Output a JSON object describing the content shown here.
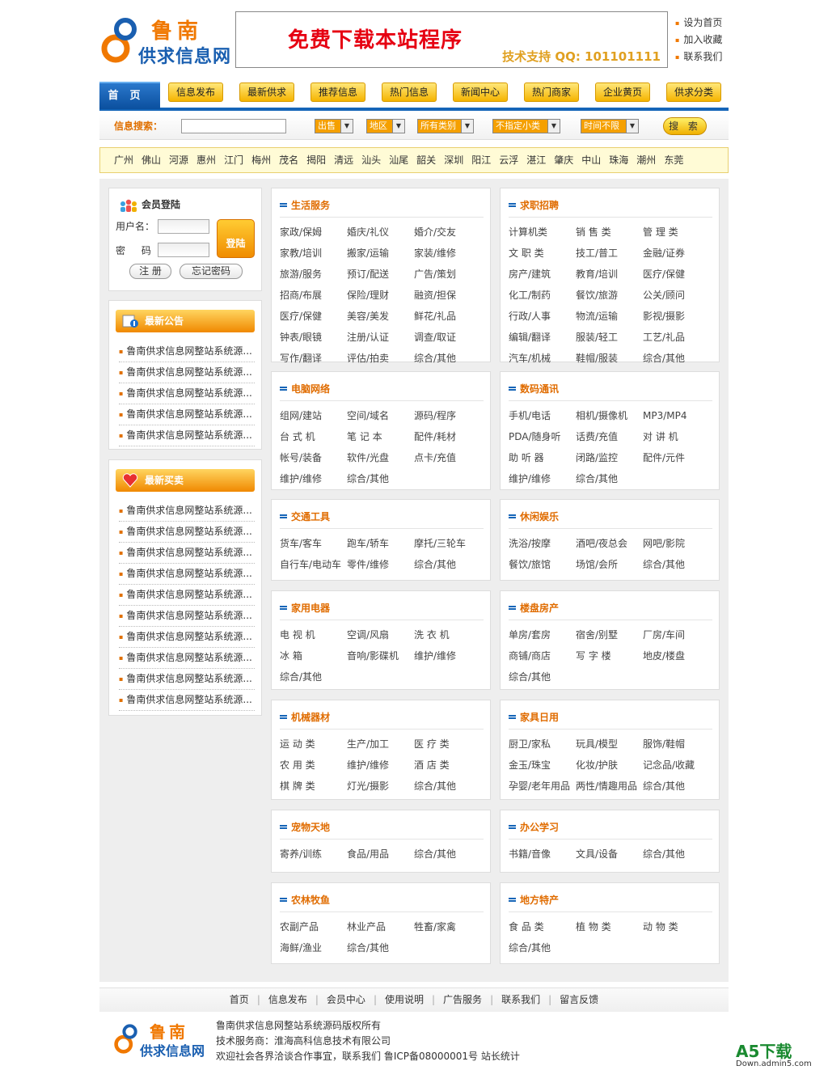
{
  "header": {
    "logo_line1": "鲁南",
    "logo_line2": "供求信息网",
    "banner_title": "免费下载本站程序",
    "banner_support": "技术支持 QQ: 101101111",
    "top_links": [
      "设为首页",
      "加入收藏",
      "联系我们"
    ]
  },
  "nav": {
    "home": "首页",
    "items": [
      "信息发布",
      "最新供求",
      "推荐信息",
      "热门信息",
      "新闻中心",
      "热门商家",
      "企业黄页",
      "供求分类"
    ]
  },
  "search": {
    "label": "信息搜索：",
    "input_value": "",
    "selects": [
      "出售",
      "地区",
      "所有类别",
      "不指定小类",
      "时间不限"
    ],
    "button": "搜 索"
  },
  "cities": [
    "广州",
    "佛山",
    "河源",
    "惠州",
    "江门",
    "梅州",
    "茂名",
    "揭阳",
    "清远",
    "汕头",
    "汕尾",
    "韶关",
    "深圳",
    "阳江",
    "云浮",
    "湛江",
    "肇庆",
    "中山",
    "珠海",
    "潮州",
    "东莞"
  ],
  "login": {
    "title": "会员登陆",
    "username_label": "用户名：",
    "password_label": "密 码：",
    "submit": "登陆",
    "register": "注 册",
    "forgot": "忘记密码"
  },
  "notice": {
    "title": "最新公告",
    "items": [
      "鲁南供求信息网整站系统源...",
      "鲁南供求信息网整站系统源...",
      "鲁南供求信息网整站系统源...",
      "鲁南供求信息网整站系统源...",
      "鲁南供求信息网整站系统源..."
    ]
  },
  "trades": {
    "title": "最新买卖",
    "items": [
      "鲁南供求信息网整站系统源...",
      "鲁南供求信息网整站系统源...",
      "鲁南供求信息网整站系统源...",
      "鲁南供求信息网整站系统源...",
      "鲁南供求信息网整站系统源...",
      "鲁南供求信息网整站系统源...",
      "鲁南供求信息网整站系统源...",
      "鲁南供求信息网整站系统源...",
      "鲁南供求信息网整站系统源...",
      "鲁南供求信息网整站系统源..."
    ]
  },
  "categories": [
    {
      "title": "生活服务",
      "items": [
        "家政/保姆",
        "婚庆/礼仪",
        "婚介/交友",
        "家教/培训",
        "搬家/运输",
        "家装/维修",
        "旅游/服务",
        "预订/配送",
        "广告/策划",
        "招商/布展",
        "保险/理财",
        "融资/担保",
        "医疗/保健",
        "美容/美发",
        "鲜花/礼品",
        "钟表/眼镜",
        "注册/认证",
        "调查/取证",
        "写作/翻译",
        "评估/拍卖",
        "综合/其他"
      ]
    },
    {
      "title": "求职招聘",
      "items": [
        "计算机类",
        "销 售 类",
        "管 理 类",
        "文 职 类",
        "技工/普工",
        "金融/证券",
        "房产/建筑",
        "教育/培训",
        "医疗/保健",
        "化工/制药",
        "餐饮/旅游",
        "公关/顾问",
        "行政/人事",
        "物流/运输",
        "影视/摄影",
        "编辑/翻译",
        "服装/轻工",
        "工艺/礼品",
        "汽车/机械",
        "鞋帽/服装",
        "综合/其他"
      ]
    },
    {
      "title": "电脑网络",
      "items": [
        "组网/建站",
        "空间/域名",
        "源码/程序",
        "台 式 机",
        "笔 记 本",
        "配件/耗材",
        "帐号/装备",
        "软件/光盘",
        "点卡/充值",
        "维护/维修",
        "综合/其他"
      ]
    },
    {
      "title": "数码通讯",
      "items": [
        "手机/电话",
        "相机/摄像机",
        "MP3/MP4",
        "PDA/随身听",
        "话费/充值",
        "对 讲 机",
        "助 听 器",
        "闭路/监控",
        "配件/元件",
        "维护/维修",
        "综合/其他"
      ]
    },
    {
      "title": "交通工具",
      "items": [
        "货车/客车",
        "跑车/轿车",
        "摩托/三轮车",
        "自行车/电动车",
        "零件/维修",
        "综合/其他"
      ]
    },
    {
      "title": "休闲娱乐",
      "items": [
        "洗浴/按摩",
        "酒吧/夜总会",
        "网吧/影院",
        "餐饮/旅馆",
        "场馆/会所",
        "综合/其他"
      ]
    },
    {
      "title": "家用电器",
      "items": [
        "电 视 机",
        "空调/风扇",
        "洗 衣 机",
        "冰 箱",
        "音响/影碟机",
        "维护/维修",
        "综合/其他"
      ]
    },
    {
      "title": "楼盘房产",
      "items": [
        "单房/套房",
        "宿舍/别墅",
        "厂房/车间",
        "商铺/商店",
        "写 字 楼",
        "地皮/楼盘",
        "综合/其他"
      ]
    },
    {
      "title": "机械器材",
      "items": [
        "运 动 类",
        "生产/加工",
        "医 疗 类",
        "农 用 类",
        "维护/维修",
        "酒 店 类",
        "棋 牌 类",
        "灯光/摄影",
        "综合/其他"
      ]
    },
    {
      "title": "家具日用",
      "items": [
        "厨卫/家私",
        "玩具/模型",
        "服饰/鞋帽",
        "金玉/珠宝",
        "化妆/护肤",
        "记念品/收藏",
        "孕婴/老年用品",
        "两性/情趣用品",
        "综合/其他"
      ]
    },
    {
      "title": "宠物天地",
      "items": [
        "寄养/训练",
        "食品/用品",
        "综合/其他"
      ]
    },
    {
      "title": "办公学习",
      "items": [
        "书籍/音像",
        "文具/设备",
        "综合/其他"
      ]
    },
    {
      "title": "农林牧鱼",
      "items": [
        "农副产品",
        "林业产品",
        "牲畜/家禽",
        "海鲜/渔业",
        "综合/其他"
      ]
    },
    {
      "title": "地方特产",
      "items": [
        "食 品 类",
        "植 物 类",
        "动 物 类",
        "综合/其他"
      ]
    }
  ],
  "footer": {
    "links": [
      "首页",
      "信息发布",
      "会员中心",
      "使用说明",
      "广告服务",
      "联系我们",
      "留言反馈"
    ],
    "copyright": "鲁南供求信息网整站系统源码版权所有",
    "provider": "技术服务商：淮海高科信息技术有限公司",
    "contact": "欢迎社会各界洽谈合作事宜，联系我们   鲁ICP备08000001号 站长统计"
  },
  "watermark": {
    "line1": "A5下载",
    "line2": "Down.admin5.com"
  },
  "colors": {
    "accent": "#f07800",
    "brand_blue": "#1565b8",
    "nav_button": "#f5b400"
  }
}
